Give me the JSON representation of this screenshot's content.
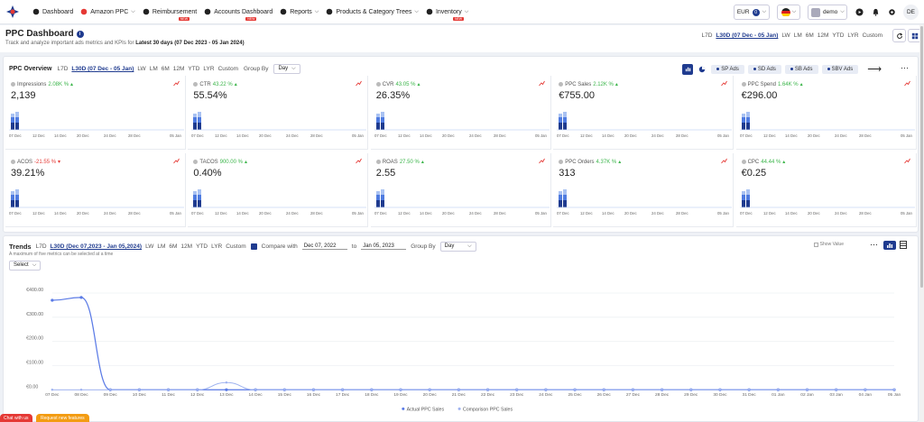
{
  "nav": {
    "items": [
      {
        "label": "Dashboard",
        "icon": "dashboard-icon",
        "caret": false,
        "badge": ""
      },
      {
        "label": "Amazon PPC",
        "icon": "amazon-ppc-icon",
        "caret": true,
        "badge": ""
      },
      {
        "label": "Reimbursement",
        "icon": "reimbursement-icon",
        "caret": false,
        "badge": "NEW"
      },
      {
        "label": "Accounts Dashboard",
        "icon": "accounts-icon",
        "caret": false,
        "badge": "NEW"
      },
      {
        "label": "Reports",
        "icon": "reports-icon",
        "caret": true,
        "badge": ""
      },
      {
        "label": "Products & Category Trees",
        "icon": "products-icon",
        "caret": true,
        "badge": ""
      },
      {
        "label": "Inventory",
        "icon": "inventory-icon",
        "caret": true,
        "badge": "NEW"
      }
    ],
    "currency": "EUR",
    "currency_count": "0",
    "user": "demo",
    "initials": "DE"
  },
  "page": {
    "title": "PPC Dashboard",
    "subtitle_prefix": "Track and analyze important ads metrics and KPIs for",
    "subtitle_range": "Latest 30 days (07 Dec 2023 - 05 Jan 2024)",
    "ranges": [
      "L7D",
      "L30D (07 Dec - 05 Jan)",
      "LW",
      "LM",
      "6M",
      "12M",
      "YTD",
      "LYR",
      "Custom"
    ],
    "active_range": 1
  },
  "overview": {
    "title": "PPC Overview",
    "ranges": [
      "L7D",
      "L30D (07 Dec - 05 Jan)",
      "LW",
      "LM",
      "6M",
      "12M",
      "YTD",
      "LYR",
      "Custom"
    ],
    "active_range": 1,
    "group_by_label": "Group By",
    "group_by_value": "Day",
    "ad_tabs": [
      "SP Ads",
      "SD Ads",
      "SB Ads",
      "SBV Ads"
    ],
    "axis_labels": [
      "07 Dec",
      "12 Dec",
      "14 Dec",
      "20 Dec",
      "24 Dec",
      "28 Dec",
      "05 Jan"
    ],
    "cards": [
      {
        "name": "Impressions",
        "change": "2.08K %",
        "dir": "up",
        "value": "2,139"
      },
      {
        "name": "CTR",
        "change": "43.22 %",
        "dir": "up",
        "value": "55.54%"
      },
      {
        "name": "CVR",
        "change": "43.05 %",
        "dir": "up",
        "value": "26.35%"
      },
      {
        "name": "PPC Sales",
        "change": "2.12K %",
        "dir": "up",
        "value": "€755.00"
      },
      {
        "name": "PPC Spend",
        "change": "1.64K %",
        "dir": "up",
        "value": "€296.00"
      },
      {
        "name": "ACOS",
        "change": "-21.55 %",
        "dir": "down",
        "value": "39.21%"
      },
      {
        "name": "TACOS",
        "change": "900.00 %",
        "dir": "up",
        "value": "0.40%"
      },
      {
        "name": "ROAS",
        "change": "27.50 %",
        "dir": "up",
        "value": "2.55"
      },
      {
        "name": "PPC Orders",
        "change": "4.37K %",
        "dir": "up",
        "value": "313"
      },
      {
        "name": "CPC",
        "change": "44.44 %",
        "dir": "up",
        "value": "€0.25"
      }
    ]
  },
  "trends": {
    "title": "Trends",
    "ranges": [
      "L7D",
      "L30D (Dec 07,2023 - Jan 05,2024)",
      "LW",
      "LM",
      "6M",
      "12M",
      "YTD",
      "LYR",
      "Custom"
    ],
    "active_range": 1,
    "compare_label": "Compare with",
    "compare_from": "Dec 07, 2022",
    "compare_sep": "to",
    "compare_to": "Jan 05, 2023",
    "group_by_label": "Group By",
    "group_by_value": "Day",
    "subtitle": "A maximum of five metrics can be selected at a time",
    "select_label": "Select",
    "show_value_label": "Show Value"
  },
  "chart_data": {
    "type": "line",
    "categories": [
      "07 Dec",
      "08 Dec",
      "09 Dec",
      "10 Dec",
      "11 Dec",
      "12 Dec",
      "13 Dec",
      "14 Dec",
      "15 Dec",
      "16 Dec",
      "17 Dec",
      "18 Dec",
      "19 Dec",
      "20 Dec",
      "21 Dec",
      "22 Dec",
      "23 Dec",
      "24 Dec",
      "25 Dec",
      "26 Dec",
      "27 Dec",
      "28 Dec",
      "29 Dec",
      "30 Dec",
      "31 Dec",
      "01 Jan",
      "02 Jan",
      "03 Jan",
      "04 Jan",
      "05 Jan"
    ],
    "y_ticks": [
      "€0.00",
      "€100.00",
      "€200.00",
      "€300.00",
      "€400.00"
    ],
    "ylim": [
      0,
      450
    ],
    "series": [
      {
        "name": "Actual PPC Sales",
        "color": "#5b7be6",
        "values": [
          370,
          382,
          0,
          0,
          0,
          0,
          0,
          0,
          0,
          0,
          0,
          0,
          0,
          0,
          0,
          0,
          0,
          0,
          0,
          0,
          0,
          0,
          0,
          0,
          0,
          0,
          0,
          0,
          0,
          0
        ]
      },
      {
        "name": "Comparison PPC Sales",
        "color": "#9fb3f0",
        "values": [
          0,
          0,
          0,
          0,
          0,
          0,
          30,
          0,
          0,
          0,
          0,
          0,
          0,
          0,
          0,
          0,
          0,
          0,
          0,
          0,
          0,
          0,
          0,
          0,
          0,
          0,
          0,
          0,
          0,
          0
        ]
      }
    ]
  },
  "footer": {
    "chat_label": "Chat with us",
    "feature_label": "Request new features"
  },
  "colors": {
    "accent": "#1f3b8f",
    "up": "#3bb54a",
    "down": "#e53935",
    "bar_dark": "#1f3b8f",
    "bar_mid": "#4f7be0",
    "bar_light": "#a9c2f2"
  }
}
